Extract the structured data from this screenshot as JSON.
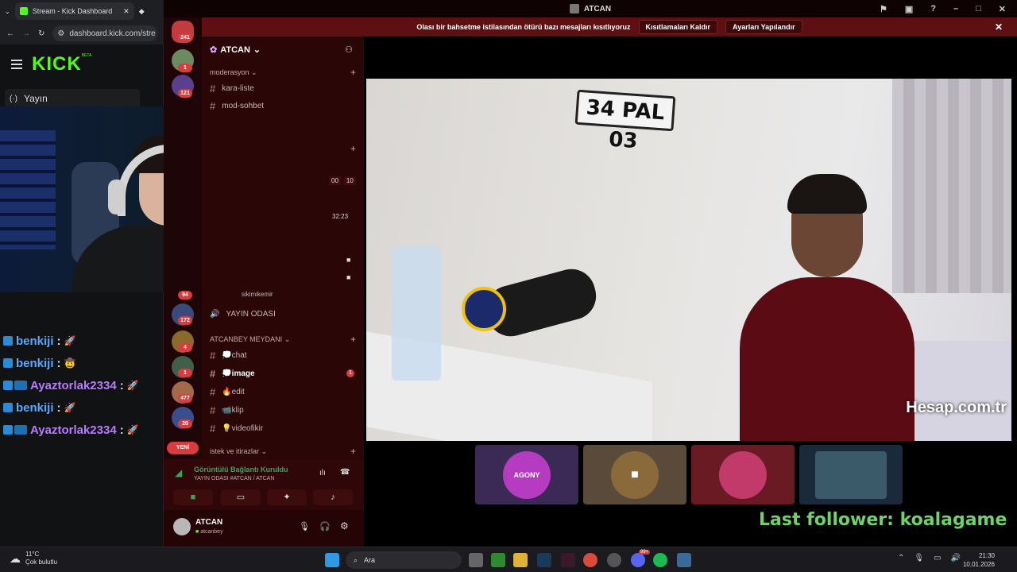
{
  "browser": {
    "tab_title": "Stream - Kick Dashboard",
    "url": "dashboard.kick.com/stre",
    "logo": "KICK",
    "logo_beta": "BETA",
    "nav_label": "Yayın"
  },
  "kick_chat": [
    {
      "user": "benkiji",
      "sep": ":",
      "color": "#5aa8ff",
      "badges": "single",
      "emote": "🚀"
    },
    {
      "user": "benkiji",
      "sep": ":",
      "color": "#5aa8ff",
      "badges": "single",
      "emote": "🤠"
    },
    {
      "user": "Ayaztorlak2334",
      "sep": ":",
      "color": "#b77bff",
      "badges": "double",
      "emote": "🚀"
    },
    {
      "user": "benkiji",
      "sep": ":",
      "color": "#5aa8ff",
      "badges": "single",
      "emote": "🚀"
    },
    {
      "user": "Ayaztorlak2334",
      "sep": ":",
      "color": "#b77bff",
      "badges": "double",
      "emote": "🚀"
    }
  ],
  "discord": {
    "window_title": "ATCAN",
    "banner": {
      "message": "Olası bir bahsetme istilasından ötürü bazı mesajları kısıtlıyoruz",
      "button1": "Kısıtlamaları Kaldır",
      "button2": "Ayarları Yapılandır"
    },
    "rail_badges": [
      "241",
      "1",
      "121",
      "94",
      "172",
      "4",
      "1",
      "477",
      "20"
    ],
    "rail_new": "YENİ",
    "server_name": "ATCAN",
    "categories": {
      "moderasyon": "moderasyon",
      "atcanbey": "ATCANBEY MEYDANI",
      "istek": "istek ve itirazlar"
    },
    "channels": {
      "kara_liste": "kara-liste",
      "mod_sohbet": "mod-sohbet",
      "sikimikemir": "sikimikemir",
      "yayin_odasi": "YAYIN ODASI",
      "chat": "💭chat",
      "image": "💭image",
      "edit": "🔥edit",
      "klip": "📹klip",
      "videofikir": "💡videofikir"
    },
    "timers": [
      "00",
      "10",
      "32:23"
    ],
    "image_unread": "1",
    "voice": {
      "status": "Görüntülü Bağlantı Kuruldu",
      "location": "YAYIN ODASI #ATCAN / ATCAN"
    },
    "user": {
      "name": "ATCAN",
      "sub": "atcanbey"
    }
  },
  "stage": {
    "plate_text": "34 PAL 03",
    "watermark": "Hesap.com.tr",
    "thumb_label": "AGONY",
    "last_follower": "Last follower: koalagame"
  },
  "taskbar": {
    "temp": "11°C",
    "weather": "Çok bulutlu",
    "search_placeholder": "Ara",
    "time": "21:30",
    "date": "10.01.2026",
    "discord_badge": "99+"
  }
}
